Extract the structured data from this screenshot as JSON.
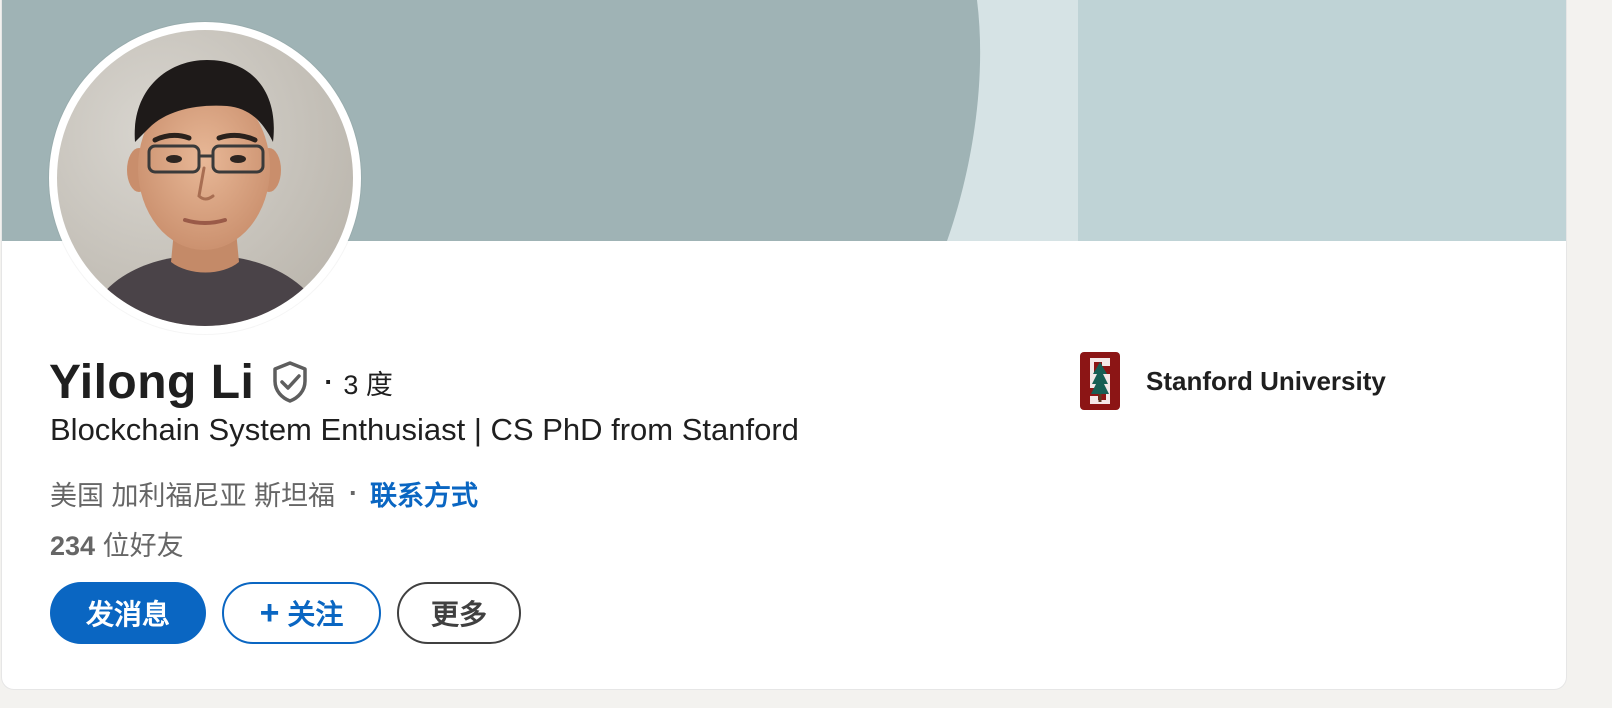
{
  "profile": {
    "name": "Yilong Li",
    "degree_dot": "·",
    "degree": "3 度",
    "headline": "Blockchain System Enthusiast | CS PhD from Stanford",
    "location": "美国 加利福尼亚 斯坦福",
    "location_sep": "·",
    "contact_link": "联系方式",
    "connections_count": "234",
    "connections_label": "位好友"
  },
  "actions": {
    "message_label": "发消息",
    "follow_plus": "+",
    "follow_label": "关注",
    "more_label": "更多"
  },
  "education": {
    "school": "Stanford University"
  },
  "icons": {
    "verified": "shield-check-icon",
    "school_logo": "stanford-logo"
  },
  "colors": {
    "accent": "#0a66c2",
    "banner_dark": "#9fb3b5",
    "banner_light": "#bfd3d6",
    "banner_mid": "#d6e3e5",
    "stanford_red": "#8c1515"
  }
}
